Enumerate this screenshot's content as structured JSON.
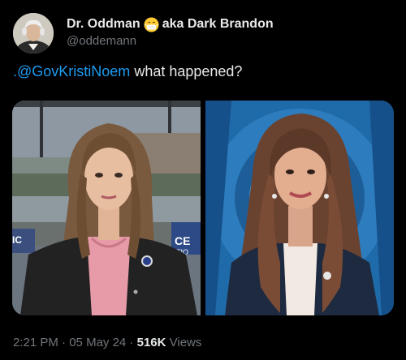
{
  "author": {
    "display_name": "Dr. Oddman",
    "display_name_suffix": "aka Dark Brandon",
    "emoji_icon": "mask-face-emoji-icon",
    "handle": "@oddemann",
    "avatar_icon": "portrait-avatar"
  },
  "tweet": {
    "mention": ".@GovKristiNoem",
    "text": " what happened?"
  },
  "media": {
    "type": "side-by-side video still",
    "panels": 2,
    "left_overlay_text": "CE",
    "left_overlay_text_2": "TIO",
    "left_overlay_text_3": "IC"
  },
  "meta": {
    "time": "2:21 PM",
    "separator": " · ",
    "date": "05 May 24",
    "separator2": " · ",
    "views_count": "516K",
    "views_label": " Views"
  },
  "colors": {
    "background": "#000000",
    "text_primary": "#e7e9ea",
    "text_secondary": "#71767b",
    "link": "#1d9bf0"
  }
}
